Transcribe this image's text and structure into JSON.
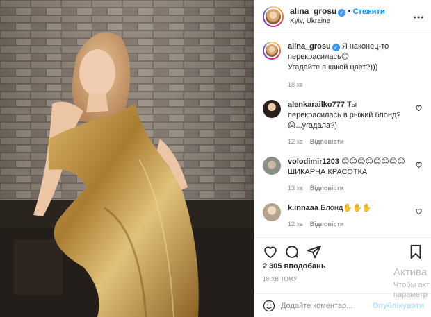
{
  "header": {
    "username": "alina_grosu",
    "verified_symbol": "✓",
    "separator": "•",
    "follow_label": "Стежити",
    "location": "Kyiv, Ukraine",
    "more_icon": "more-horizontal-icon"
  },
  "caption": {
    "username": "alina_grosu",
    "text_line1": "Я наконец-то перекрасилась😊",
    "text_line2": "Угадайте в какой цвет?)))",
    "time": "18 хв"
  },
  "comments": [
    {
      "username": "alenkarailko777",
      "text": "Ты перекрасилась в рыжий блонд?😱...угадала?)",
      "time": "12 хв",
      "reply_label": "Відповісти"
    },
    {
      "username": "volodimir1203",
      "text": "😊😊😊😊😊😊😊😊 ШИКАРНА КРАСОТКА",
      "time": "13 хв",
      "reply_label": "Відповісти"
    },
    {
      "username": "k.innaaa",
      "text": "Блонд✋✋✋",
      "time": "12 хв",
      "reply_label": "Відповісти"
    }
  ],
  "actions": {
    "like_icon": "heart-icon",
    "comment_icon": "comment-icon",
    "share_icon": "paper-plane-icon",
    "save_icon": "bookmark-icon"
  },
  "likes_text": "2 305 вподобань",
  "posted_ago": "18 ХВ ТОМУ",
  "add_comment": {
    "placeholder": "Додайте коментар...",
    "post_label": "Опублікувати",
    "emoji_icon": "smiley-icon"
  },
  "watermark": {
    "line1": "Актива",
    "line2": "Чтобы акт",
    "line3": "параметр"
  },
  "colors": {
    "link_blue": "#0095f6",
    "muted": "#8e8e8e",
    "post_disabled": "#b2dffc",
    "dress_gold": "#b58a3a"
  }
}
